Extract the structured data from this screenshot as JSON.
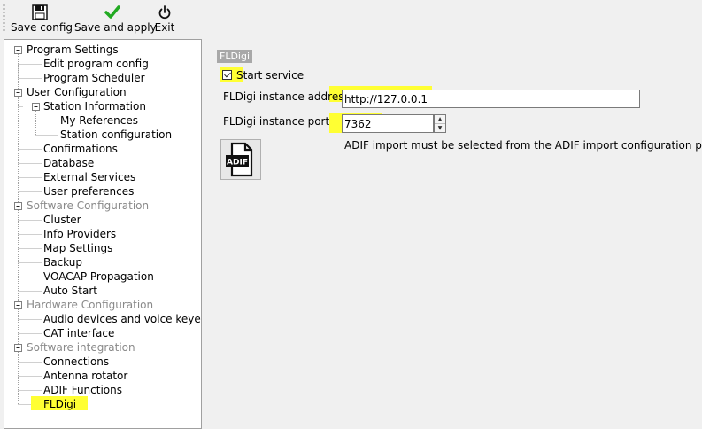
{
  "toolbar": {
    "save_config": "Save config",
    "save_and_apply": "Save and apply",
    "exit": "Exit"
  },
  "tree": {
    "items": [
      {
        "label": "Program Settings"
      },
      {
        "label": "Edit program config"
      },
      {
        "label": "Program Scheduler"
      },
      {
        "label": "User Configuration"
      },
      {
        "label": "Station Information"
      },
      {
        "label": "My References"
      },
      {
        "label": "Station configuration"
      },
      {
        "label": "Confirmations"
      },
      {
        "label": "Database"
      },
      {
        "label": "External Services"
      },
      {
        "label": "User preferences"
      },
      {
        "label": "Software Configuration"
      },
      {
        "label": "Cluster"
      },
      {
        "label": "Info Providers"
      },
      {
        "label": "Map Settings"
      },
      {
        "label": "Backup"
      },
      {
        "label": "VOACAP Propagation"
      },
      {
        "label": "Auto Start"
      },
      {
        "label": "Hardware Configuration"
      },
      {
        "label": "Audio devices and voice keyer"
      },
      {
        "label": "CAT interface"
      },
      {
        "label": "Software integration"
      },
      {
        "label": "Connections"
      },
      {
        "label": "Antenna rotator"
      },
      {
        "label": "ADIF Functions"
      },
      {
        "label": "FLDigi"
      }
    ],
    "selected": "FLDigi"
  },
  "panel": {
    "group_title": "FLDigi",
    "start_service": "Start service",
    "start_service_checked": true,
    "address_label": "FLDigi instance address",
    "address_value": "http://127.0.0.1",
    "port_label": "FLDigi instance port",
    "port_value": "7362",
    "note": "ADIF import must be selected from the ADIF import configuration page.",
    "adif_icon_text": "ADIF"
  },
  "colors": {
    "highlight": "#ffff33",
    "disabled_text": "#8a8a8a",
    "save_and_apply_icon": "#22aa22"
  }
}
